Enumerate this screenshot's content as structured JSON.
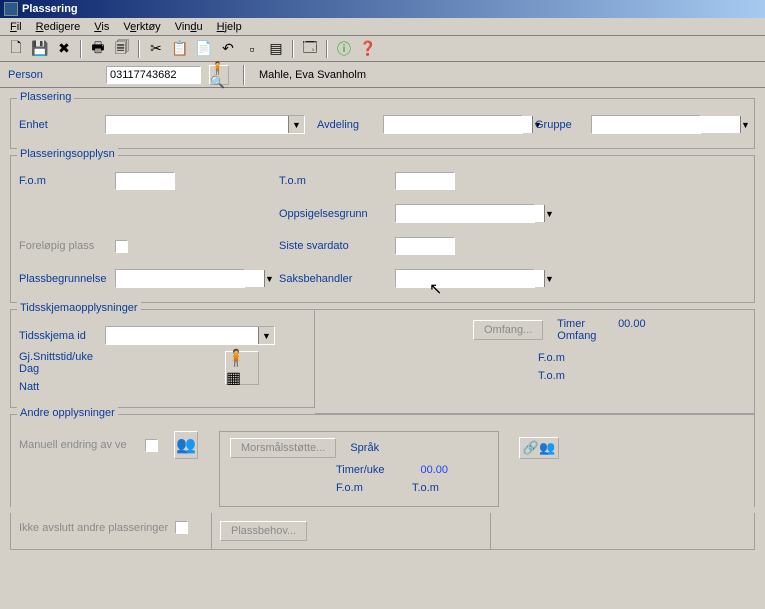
{
  "window": {
    "title": "Plassering"
  },
  "menu": {
    "fil": "Fil",
    "redigere": "Redigere",
    "vis": "Vis",
    "verktoy": "Verktøy",
    "vindu": "Vindu",
    "hjelp": "Hjelp"
  },
  "person": {
    "label": "Person",
    "id": "03117743682",
    "name": "Mahle, Eva Svanholm"
  },
  "plassering": {
    "legend": "Plassering",
    "enhet_label": "Enhet",
    "avdeling_label": "Avdeling",
    "gruppe_label": "Gruppe"
  },
  "opplysn": {
    "legend": "Plasseringsopplysn",
    "fom": "F.o.m",
    "tom": "T.o.m",
    "oppsigelsesgrunn": "Oppsigelsesgrunn",
    "forelopig": "Foreløpig plass",
    "siste_svardato": "Siste svardato",
    "plassbegrunnelse": "Plassbegrunnelse",
    "saksbehandler": "Saksbehandler"
  },
  "tidsskjema": {
    "legend": "Tidsskjemaopplysninger",
    "tidsskjema_id": "Tidsskjema id",
    "gjsnitt": "Gj.Snittstid/uke",
    "dag": "Dag",
    "natt": "Natt",
    "omfang_btn": "Omfang...",
    "timer_label": "Timer",
    "timer_val": "00.00",
    "omfang_label": "Omfang",
    "fom": "F.o.m",
    "tom": "T.o.m"
  },
  "andre": {
    "legend": "Andre opplysninger",
    "manuell": "Manuell endring av ve",
    "morsmalsstotte": "Morsmålsstøtte...",
    "sprak": "Språk",
    "timer_uke": "Timer/uke",
    "timer_uke_val": "00.00",
    "fom": "F.o.m",
    "tom": "T.o.m",
    "ikke_avslutt": "Ikke avslutt andre plasseringer",
    "plassbehov": "Plassbehov..."
  }
}
